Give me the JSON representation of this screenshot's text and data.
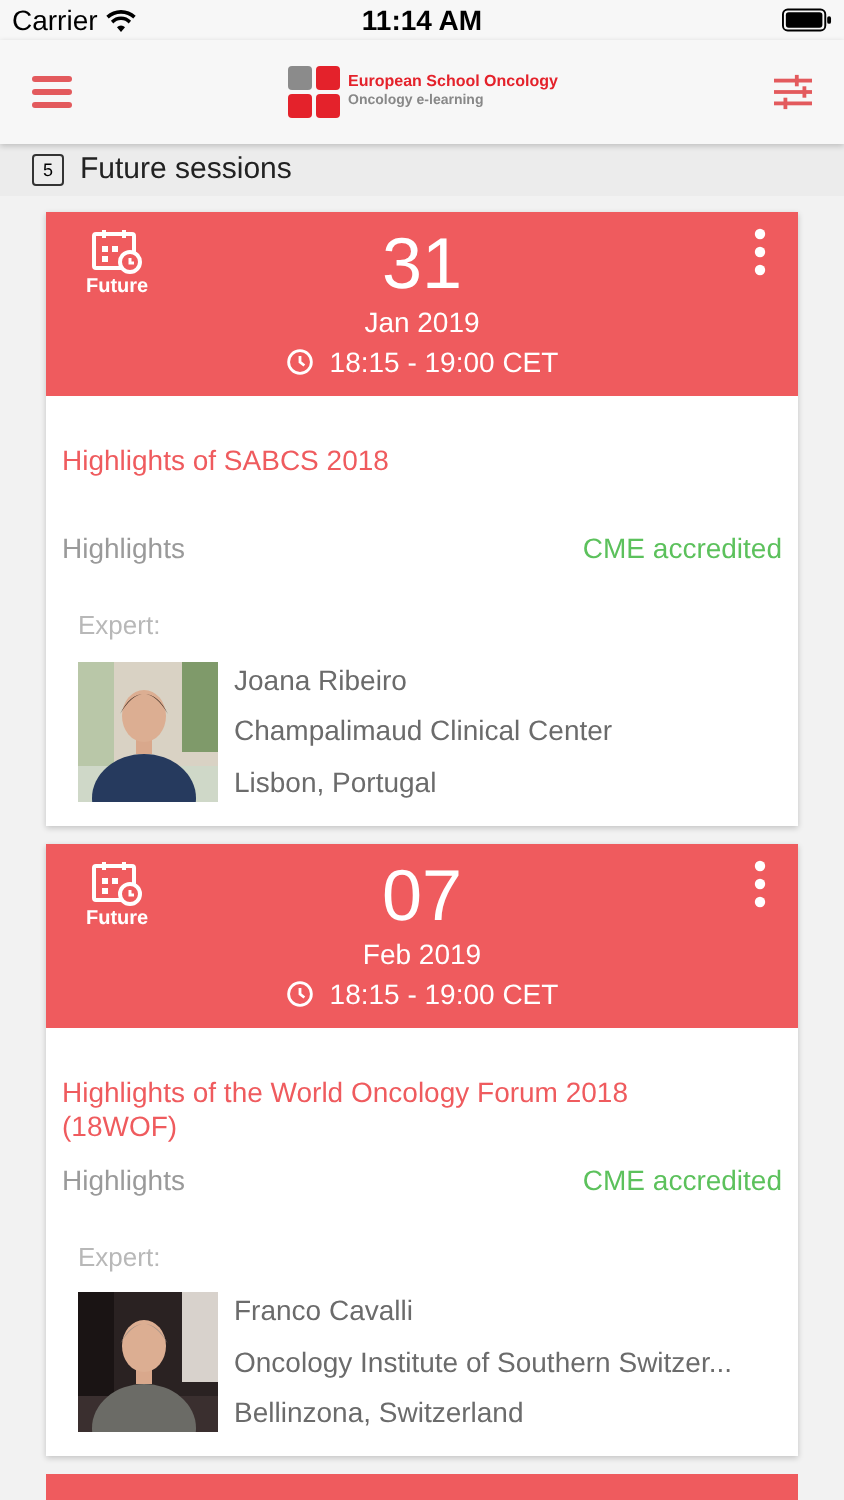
{
  "status_bar": {
    "carrier": "Carrier",
    "time": "11:14 AM"
  },
  "header": {
    "brand": "European School Oncology",
    "tagline": "Oncology e-learning"
  },
  "section": {
    "title": "Future sessions",
    "calendar_day": "5"
  },
  "sessions": [
    {
      "badge": "Future",
      "day": "31",
      "month": "Jan 2019",
      "time": "18:15 - 19:00 CET",
      "title": "Highlights of SABCS 2018",
      "category": "Highlights",
      "accreditation": "CME accredited",
      "expert_label": "Expert:",
      "expert": {
        "name": "Joana Ribeiro",
        "institution": "Champalimaud Clinical Center",
        "location": "Lisbon, Portugal"
      }
    },
    {
      "badge": "Future",
      "day": "07",
      "month": "Feb 2019",
      "time": "18:15 - 19:00 CET",
      "title": "Highlights of the World Oncology Forum 2018 (18WOF)",
      "category": "Highlights",
      "accreditation": "CME accredited",
      "expert_label": "Expert:",
      "expert": {
        "name": "Franco Cavalli",
        "institution": "Oncology Institute of Southern Switzer...",
        "location": "Bellinzona, Switzerland"
      }
    }
  ]
}
